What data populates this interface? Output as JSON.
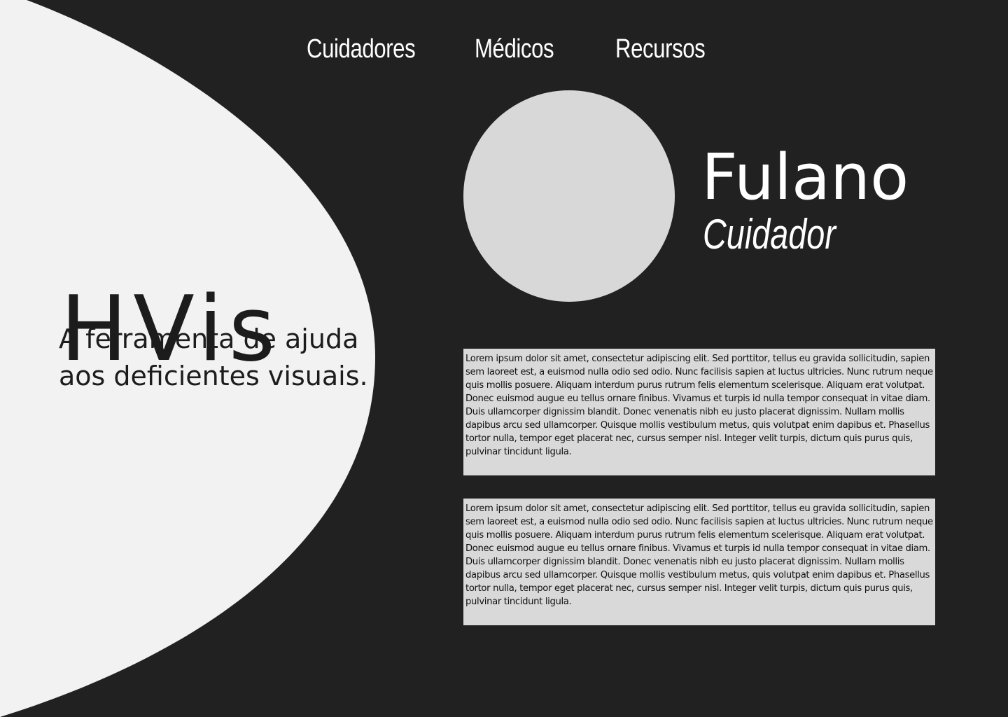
{
  "nav": {
    "items": [
      {
        "label": "Cuidadores"
      },
      {
        "label": "Médicos"
      },
      {
        "label": "Recursos"
      }
    ]
  },
  "brand": {
    "title": "HVis",
    "tagline_line1": "A ferramenta de ajuda",
    "tagline_line2": "aos deficientes visuais."
  },
  "profile": {
    "name": "Fulano",
    "role": "Cuidador"
  },
  "content": {
    "paragraphs": [
      "Lorem ipsum dolor sit amet, consectetur adipiscing elit. Sed porttitor, tellus eu gravida sollicitudin, sapien sem laoreet est, a euismod nulla odio sed odio. Nunc facilisis sapien at luctus ultricies. Nunc rutrum neque quis mollis posuere. Aliquam interdum purus rutrum felis elementum scelerisque. Aliquam erat volutpat. Donec euismod augue eu tellus ornare finibus. Vivamus et turpis id nulla tempor consequat in vitae diam. Duis ullamcorper dignissim blandit. Donec venenatis nibh eu justo placerat dignissim. Nullam mollis dapibus arcu sed ullamcorper. Quisque mollis vestibulum metus, quis volutpat enim dapibus et. Phasellus tortor nulla, tempor eget placerat nec, cursus semper nisl. Integer velit turpis, dictum quis purus quis, pulvinar tincidunt ligula.",
      "Lorem ipsum dolor sit amet, consectetur adipiscing elit. Sed porttitor, tellus eu gravida sollicitudin, sapien sem laoreet est, a euismod nulla odio sed odio. Nunc facilisis sapien at luctus ultricies. Nunc rutrum neque quis mollis posuere. Aliquam interdum purus rutrum felis elementum scelerisque. Aliquam erat volutpat. Donec euismod augue eu tellus ornare finibus. Vivamus et turpis id nulla tempor consequat in vitae diam. Duis ullamcorper dignissim blandit. Donec venenatis nibh eu justo placerat dignissim. Nullam mollis dapibus arcu sed ullamcorper. Quisque mollis vestibulum metus, quis volutpat enim dapibus et. Phasellus tortor nulla, tempor eget placerat nec, cursus semper nisl. Integer velit turpis, dictum quis purus quis, pulvinar tincidunt ligula."
    ]
  },
  "colors": {
    "background": "#212121",
    "panel": "#f2f2f2",
    "avatar": "#d8d8d8",
    "text_box": "#d9d9d9",
    "text_dark": "#1c1c1c",
    "text_light": "#ffffff"
  }
}
